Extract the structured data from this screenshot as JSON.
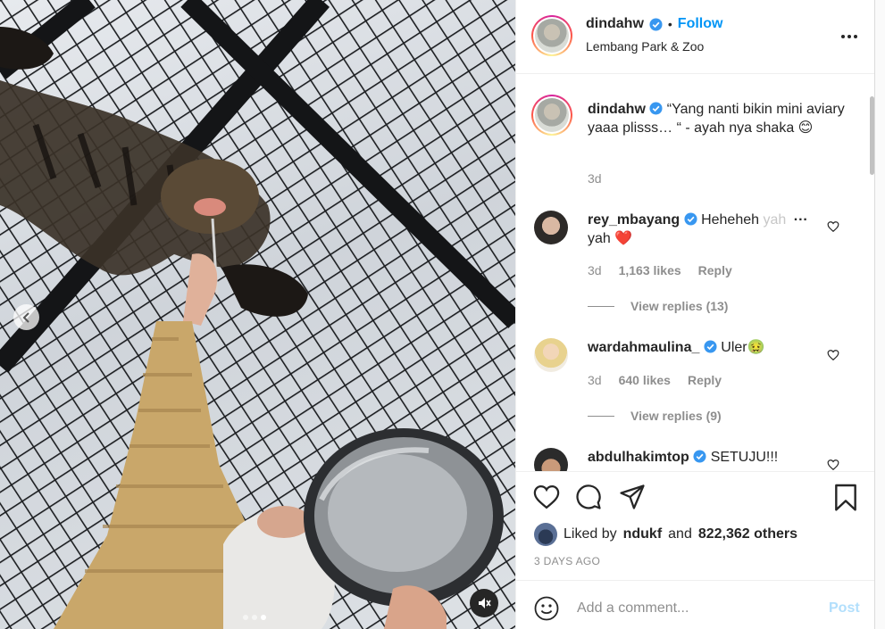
{
  "media": {
    "carousel": {
      "total": 3,
      "active": 3
    },
    "prev_icon": "chevron-left-icon",
    "mute_icon": "speaker-muted-icon"
  },
  "header": {
    "username": "dindahw",
    "bullet": "•",
    "follow_label": "Follow",
    "location": "Lembang Park & Zoo",
    "more_icon": "more-horizontal-icon"
  },
  "caption": {
    "username": "dindahw",
    "text": "“Yang nanti bikin mini aviary yaaa plisss… “ - ayah nya shaka 😊",
    "time": "3d"
  },
  "comments": [
    {
      "username": "rey_mbayang",
      "text": "Heheheh",
      "text_faded": "yah",
      "text_line2": "yah ❤️",
      "time": "3d",
      "likes": "1,163 likes",
      "reply_label": "Reply",
      "view_replies": "View replies (13)"
    },
    {
      "username": "wardahmaulina_",
      "text": "Uler🤢",
      "time": "3d",
      "likes": "640 likes",
      "reply_label": "Reply",
      "view_replies": "View replies (9)"
    },
    {
      "username": "abdulhakimtop",
      "text": "SETUJU!!!"
    }
  ],
  "actions": {
    "liked_by_prefix": "Liked by",
    "liked_by_user": "ndukf",
    "liked_by_and": "and",
    "liked_by_others": "822,362 others",
    "date": "3 DAYS AGO"
  },
  "add_comment": {
    "placeholder": "Add a comment...",
    "post_label": "Post"
  },
  "colors": {
    "accent": "#0095f6",
    "verified": "#3897f0",
    "post_disabled": "#b2dffc",
    "muted_text": "#8e8e8e"
  }
}
